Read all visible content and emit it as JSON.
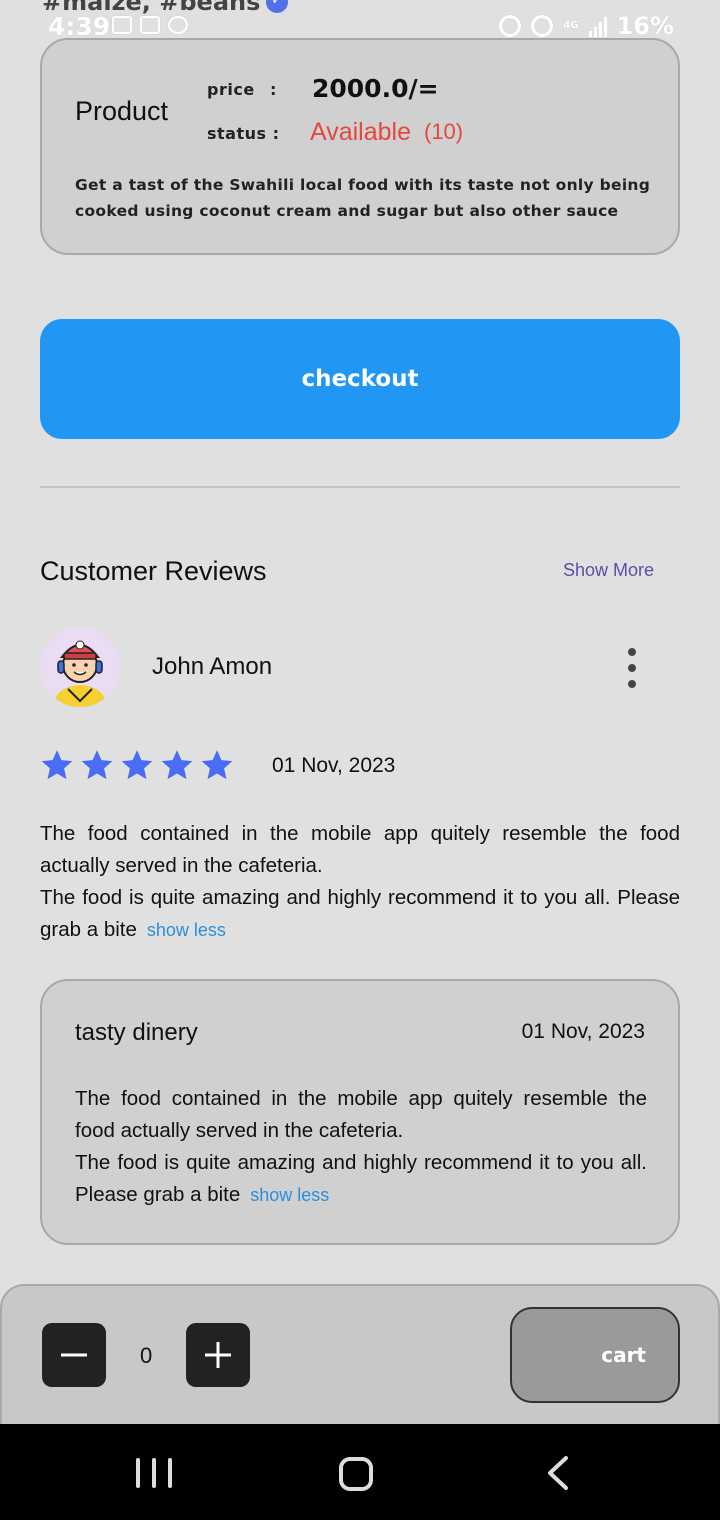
{
  "status_bar": {
    "prev_tags": "#maize, #beans",
    "time": "4:39",
    "network": "4G",
    "battery": "16%"
  },
  "product": {
    "title": "Product",
    "price_label": "price",
    "price_colon": ":",
    "price_value": "2000.0/=",
    "status_label": "status :",
    "status_value": "Available",
    "status_count": "(10)",
    "description": "Get a tast of the Swahili local food with its taste not only being cooked using coconut cream and sugar but also other sauce",
    "status_color": "#e8453c"
  },
  "checkout": {
    "label": "checkout",
    "color": "#2196f3"
  },
  "reviews": {
    "title": "Customer Reviews",
    "show_more": "Show More",
    "items": [
      {
        "name": "John Amon",
        "rating": 5,
        "date": "01 Nov, 2023",
        "text_line1": "The food contained in the mobile app quitely resemble the food actually served in the cafeteria.",
        "text_line2": "The food is quite amazing and highly recommend it to you all. Please grab a bite",
        "toggle": "show less",
        "avatar_icon": "chef-avatar-icon",
        "reply": {
          "name": "tasty dinery",
          "date": "01 Nov, 2023",
          "text_line1": "The food contained in the mobile app quitely resemble the food actually served in the cafeteria.",
          "text_line2": "The food is quite amazing and highly recommend it to you all. Please grab a bite",
          "toggle": "show less"
        }
      }
    ]
  },
  "cart_bar": {
    "quantity": "0",
    "cart_label": "cart"
  },
  "colors": {
    "star": "#4a6cf7",
    "link": "#2b8fde",
    "show_more": "#5b4fa5"
  }
}
